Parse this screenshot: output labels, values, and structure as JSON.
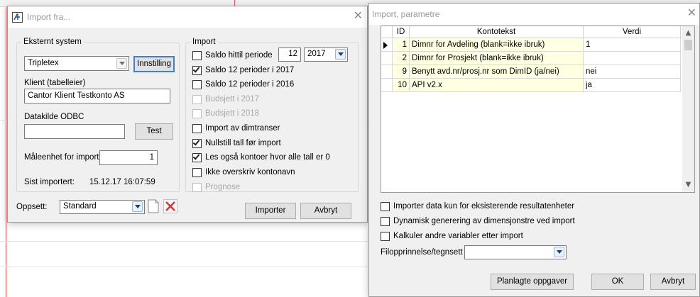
{
  "import_dialog": {
    "title": "Import fra...",
    "external_system": {
      "legend": "Eksternt system",
      "system_value": "Tripletex",
      "settings_button": "Innstilling",
      "client_label": "Klient (tabelleier)",
      "client_value": "Cantor Klient Testkonto AS",
      "datasource_label": "Datakilde ODBC",
      "datasource_value": "",
      "test_button": "Test",
      "unit_label": "Måleenhet for import",
      "unit_value": "1",
      "last_import_label": "Sist importert:",
      "last_import_value": "15.12.17 16:07:59"
    },
    "import_group": {
      "legend": "Import",
      "period_value": "12",
      "year_value": "2017",
      "options": [
        {
          "label": "Saldo hittil periode",
          "checked": false,
          "enabled": true
        },
        {
          "label": "Saldo 12 perioder i 2017",
          "checked": true,
          "enabled": true
        },
        {
          "label": "Saldo 12 perioder i 2016",
          "checked": false,
          "enabled": true
        },
        {
          "label": "Budsjett i 2017",
          "checked": false,
          "enabled": false
        },
        {
          "label": "Budsjett i 2018",
          "checked": false,
          "enabled": false
        },
        {
          "label": "Import av dimtranser",
          "checked": false,
          "enabled": true
        },
        {
          "label": "Nullstill tall før import",
          "checked": true,
          "enabled": true
        },
        {
          "label": "Les også kontoer hvor alle tall er 0",
          "checked": true,
          "enabled": true
        },
        {
          "label": "Ikke overskriv kontonavn",
          "checked": false,
          "enabled": true
        },
        {
          "label": "Prognose",
          "checked": false,
          "enabled": false
        }
      ]
    },
    "setup_label": "Oppsett:",
    "setup_value": "Standard",
    "import_button": "Importer",
    "cancel_button": "Avbryt"
  },
  "params_dialog": {
    "title": "Import, parametre",
    "grid": {
      "columns": [
        "ID",
        "Kontotekst",
        "Verdi"
      ],
      "rows": [
        {
          "id": "1",
          "text": "Dimnr for Avdeling (blank=ikke ibruk)",
          "value": "1"
        },
        {
          "id": "2",
          "text": "Dimnr for Prosjekt (blank=ikke ibruk)",
          "value": ""
        },
        {
          "id": "9",
          "text": "Benytt avd.nr/prosj.nr som DimID (ja/nei)",
          "value": "nei"
        },
        {
          "id": "10",
          "text": "API v2.x",
          "value": "ja"
        }
      ]
    },
    "options": [
      {
        "label": "Importer data kun for eksisterende resultatenheter",
        "checked": false
      },
      {
        "label": "Dynamisk generering av dimensjonstre ved import",
        "checked": false
      },
      {
        "label": "Kalkuler andre variabler etter import",
        "checked": false
      }
    ],
    "encoding_label": "Filopprinnelse/tegnsett",
    "encoding_value": "",
    "planned_button": "Planlagte oppgaver",
    "ok_button": "OK",
    "cancel_button": "Avbryt"
  },
  "colors": {
    "dialog_bg": "#f0f0f0",
    "focus_blue": "#3c7fd9",
    "grid_yellow": "#ffffe1",
    "delete_red": "#d9342b"
  }
}
